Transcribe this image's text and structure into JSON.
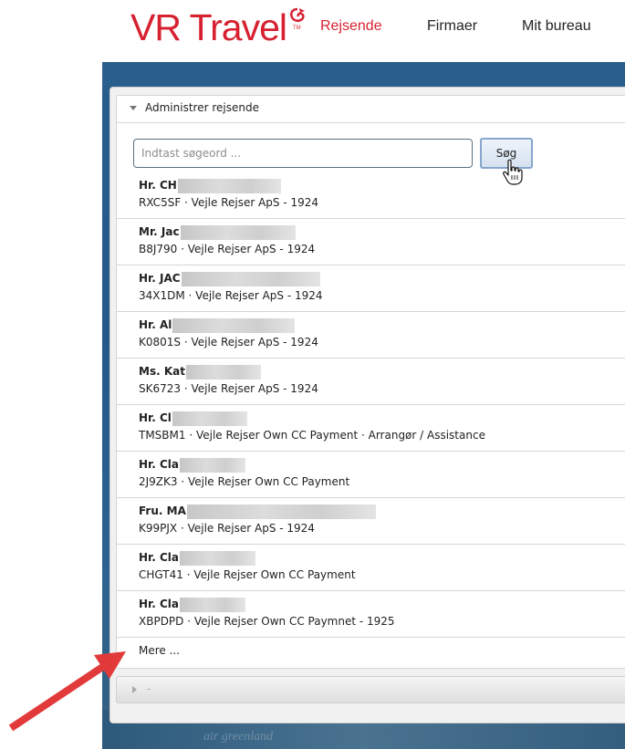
{
  "header": {
    "logo": "VR Travel",
    "logo_tm": "TM",
    "nav": [
      {
        "label": "Rejsende",
        "active": true
      },
      {
        "label": "Firmaer",
        "active": false
      },
      {
        "label": "Mit bureau",
        "active": false
      }
    ]
  },
  "panel": {
    "title": "Administrer rejsende",
    "search": {
      "placeholder": "Indtast søgeord ...",
      "value": ""
    },
    "search_button": "Søg",
    "travelers": [
      {
        "name": "Hr. CH",
        "detail": "RXC5SF · Vejle Rejser ApS - 1924"
      },
      {
        "name": "Mr. Jac",
        "detail": "B8J790 · Vejle Rejser ApS - 1924"
      },
      {
        "name": "Hr. JAC",
        "detail": "34X1DM · Vejle Rejser ApS - 1924"
      },
      {
        "name": "Hr. Al",
        "detail": "K0801S · Vejle Rejser ApS - 1924"
      },
      {
        "name": "Ms. Kat",
        "detail": "SK6723 · Vejle Rejser ApS - 1924"
      },
      {
        "name": "Hr. Cl",
        "detail": "TMSBM1 · Vejle Rejser Own CC Payment · Arrangør / Assistance"
      },
      {
        "name": "Hr. Cla",
        "detail": "2J9ZK3 · Vejle Rejser Own CC Payment"
      },
      {
        "name": "Fru. MA",
        "detail": "K99PJX · Vejle Rejser ApS - 1924"
      },
      {
        "name": "Hr. Cla",
        "detail": "CHGT41 · Vejle Rejser Own CC Payment"
      },
      {
        "name": "Hr. Cla",
        "detail": "XBPDPD · Vejle Rejser Own CC Paymnet - 1925"
      }
    ],
    "more_label": "Mere ...",
    "collapsed_section": {
      "label": "-"
    }
  },
  "background_watermark": "air greenland",
  "colors": {
    "brand_red": "#d72131",
    "header_blue": "#2a5e8c",
    "annotation_arrow": "#e23a3a"
  }
}
